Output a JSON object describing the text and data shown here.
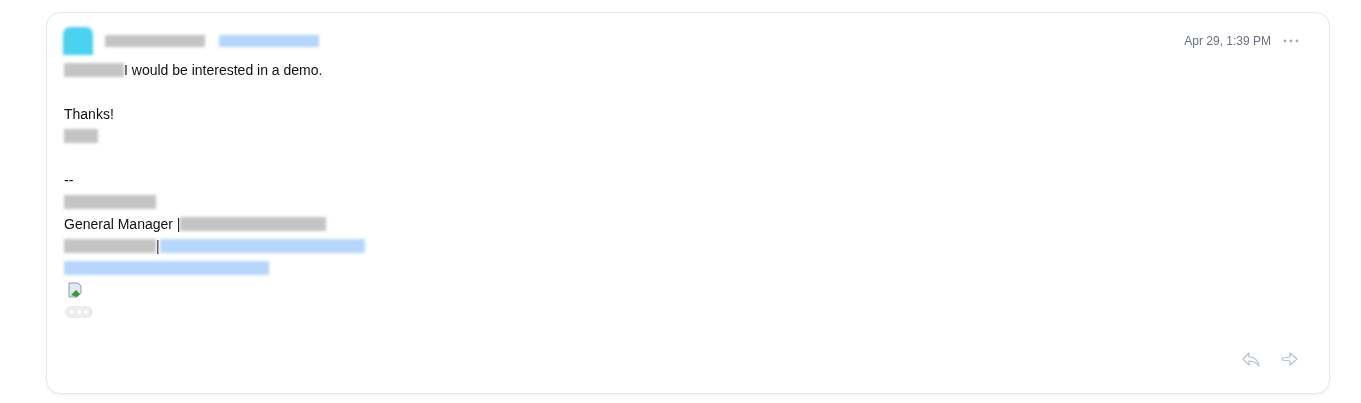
{
  "message": {
    "sender": [
      {
        "kind": "redacted-avatar"
      },
      {
        "kind": "redacted"
      },
      {
        "kind": "redacted-link"
      }
    ],
    "timestamp": "Apr 29, 1:39 PM",
    "body": [
      {
        "kind": "line",
        "parts": [
          {
            "kind": "redacted"
          },
          {
            "kind": "text",
            "text": "I would be interested in a demo."
          }
        ]
      },
      {
        "kind": "blank"
      },
      {
        "kind": "line",
        "parts": [
          {
            "kind": "text",
            "text": "Thanks!"
          }
        ]
      },
      {
        "kind": "line",
        "parts": [
          {
            "kind": "redacted"
          }
        ]
      },
      {
        "kind": "blank"
      },
      {
        "kind": "line",
        "parts": [
          {
            "kind": "text",
            "text": "--"
          }
        ]
      },
      {
        "kind": "line",
        "parts": [
          {
            "kind": "redacted"
          }
        ]
      },
      {
        "kind": "line",
        "parts": [
          {
            "kind": "text",
            "text": "General Manager |"
          },
          {
            "kind": "redacted"
          }
        ]
      },
      {
        "kind": "line",
        "parts": [
          {
            "kind": "redacted"
          },
          {
            "kind": "text",
            "text": "|"
          },
          {
            "kind": "redacted-link"
          }
        ]
      },
      {
        "kind": "line",
        "parts": [
          {
            "kind": "redacted-link"
          }
        ]
      },
      {
        "kind": "line",
        "parts": [
          {
            "kind": "broken-image"
          }
        ]
      },
      {
        "kind": "line",
        "parts": [
          {
            "kind": "more"
          }
        ]
      }
    ]
  }
}
